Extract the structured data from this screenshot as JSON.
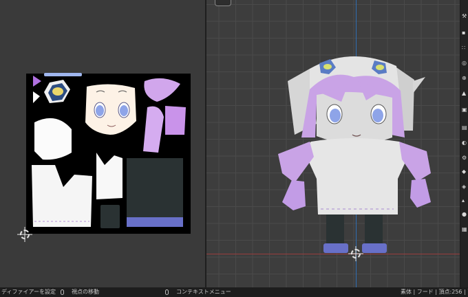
{
  "status_bar": {
    "left_action": "ディファイアーを設定",
    "middle_action": "視点の移動",
    "right_action": "コンテキストメニュー",
    "stats": "素体 | フード | 頂点:256 | 面"
  },
  "colors": {
    "uv_background": "#3a3a3a",
    "viewport_background": "#3d3d3d",
    "axis_x": "#9a3c3c",
    "axis_y": "#2f6fb5",
    "hair_purple": "#c9a3e6",
    "eye_blue": "#8ea4e8",
    "hood_white": "#e4e4e4",
    "skirt_dark": "#2a3233",
    "shoe_indigo": "#6870c8"
  },
  "side_toolbar_icons": [
    "wrench-icon",
    "object-icon",
    "particles-icon",
    "physics-icon",
    "constraint-icon",
    "data-icon",
    "material-icon",
    "texture-icon",
    "world-icon",
    "render-icon",
    "output-icon",
    "view-layer-icon",
    "scene-icon",
    "collection-icon",
    "grid-icon"
  ]
}
